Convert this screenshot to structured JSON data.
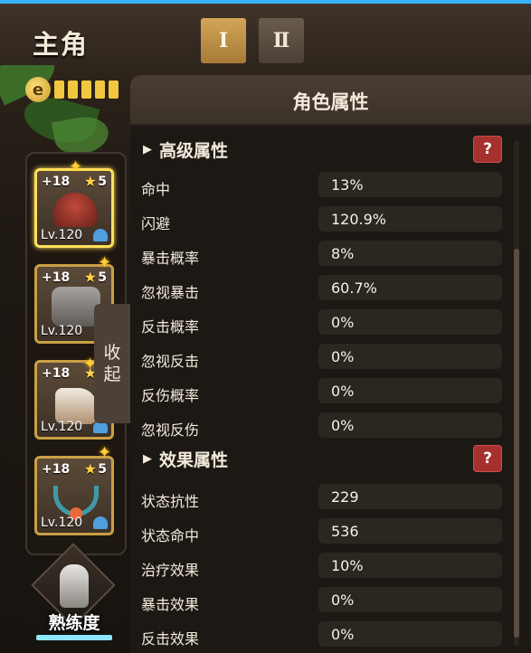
{
  "header": {
    "title": "主角",
    "tabs": [
      "Ⅰ",
      "Ⅱ"
    ]
  },
  "exp_bar": {
    "icon": "exp-icon",
    "filled_cells": 5
  },
  "equipment_slots": [
    {
      "enhance": "+18",
      "stars": "5",
      "level": "Lv.120",
      "item": "helmet-icon",
      "selected": true
    },
    {
      "enhance": "+18",
      "stars": "5",
      "level": "Lv.120",
      "item": "armor-icon",
      "selected": false
    },
    {
      "enhance": "+18",
      "stars": "",
      "level": "Lv.120",
      "item": "boots-icon",
      "selected": false
    },
    {
      "enhance": "+18",
      "stars": "5",
      "level": "Lv.120",
      "item": "necklace-icon",
      "selected": false
    }
  ],
  "collapse": {
    "label_1": "收",
    "label_2": "起"
  },
  "mastery": {
    "label": "熟练度"
  },
  "attributes_panel": {
    "title": "角色属性",
    "sections": [
      {
        "title": "高级属性",
        "help": "?",
        "rows": [
          {
            "name": "命中",
            "value": "13%"
          },
          {
            "name": "闪避",
            "value": "120.9%"
          },
          {
            "name": "暴击概率",
            "value": "8%"
          },
          {
            "name": "忽视暴击",
            "value": "60.7%"
          },
          {
            "name": "反击概率",
            "value": "0%"
          },
          {
            "name": "忽视反击",
            "value": "0%"
          },
          {
            "name": "反伤概率",
            "value": "0%"
          },
          {
            "name": "忽视反伤",
            "value": "0%"
          }
        ]
      },
      {
        "title": "效果属性",
        "help": "?",
        "rows": [
          {
            "name": "状态抗性",
            "value": "229"
          },
          {
            "name": "状态命中",
            "value": "536"
          },
          {
            "name": "治疗效果",
            "value": "10%"
          },
          {
            "name": "暴击效果",
            "value": "0%"
          },
          {
            "name": "反击效果",
            "value": "0%"
          }
        ]
      }
    ]
  },
  "colors": {
    "accent_gold": "#ffd24a",
    "help_red": "#a5302c",
    "top_line": "#39b3ff"
  }
}
